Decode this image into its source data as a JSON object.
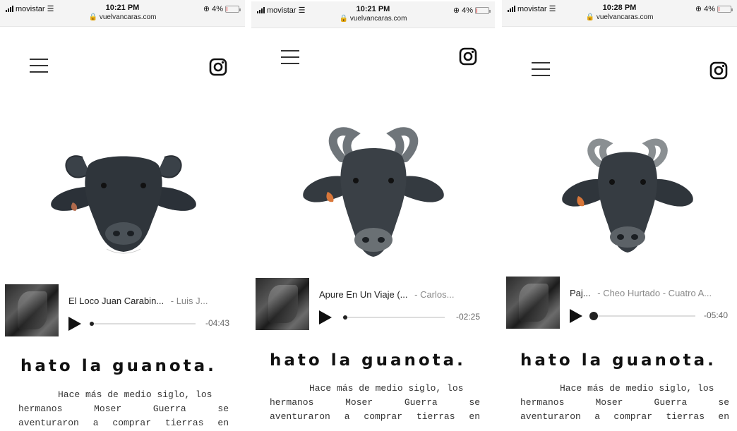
{
  "screens": [
    {
      "status": {
        "carrier": "movistar",
        "time": "10:21 PM",
        "url": "vuelvancaras.com",
        "battery": "4%"
      },
      "player": {
        "title": "El Loco Juan Carabin...",
        "artist": "- Luis J...",
        "time": "-04:43",
        "progress": 0.0
      },
      "heading": "hato la guanota.",
      "paragraph_lines": [
        "Hace más de medio siglo, los",
        "hermanos Moser Guerra se",
        "aventuraron a comprar tierras en"
      ]
    },
    {
      "status": {
        "carrier": "movistar",
        "time": "10:21 PM",
        "url": "vuelvancaras.com",
        "battery": "4%"
      },
      "player": {
        "title": "Apure En Un Viaje (...",
        "artist": "- Carlos...",
        "time": "-02:25",
        "progress": 0.0
      },
      "heading": "hato la guanota.",
      "paragraph_lines": [
        "Hace más de medio siglo, los",
        "hermanos Moser Guerra se",
        "aventuraron a comprar tierras en"
      ]
    },
    {
      "status": {
        "carrier": "movistar",
        "time": "10:28 PM",
        "url": "vuelvancaras.com",
        "battery": "4%"
      },
      "player": {
        "title": "Paj...",
        "artist": "- Cheo Hurtado - Cuatro A...",
        "time": "-05:40",
        "progress": 0.0
      },
      "heading": "hato la guanota.",
      "paragraph_lines": [
        "Hace más de medio siglo, los",
        "hermanos Moser Guerra se",
        "aventuraron a comprar tierras en"
      ]
    }
  ],
  "icons": {
    "menu": "hamburger-menu-icon",
    "social": "instagram-icon",
    "play": "play-icon"
  },
  "colors": {
    "text": "#111111",
    "muted": "#888888",
    "track": "#dddddd"
  }
}
